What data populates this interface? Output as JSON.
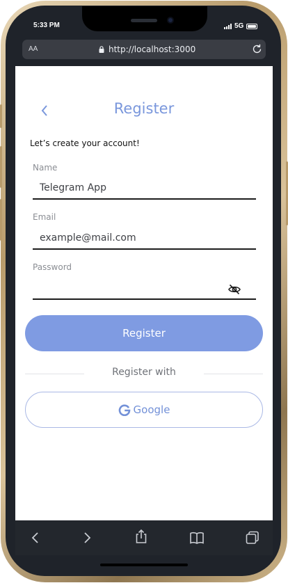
{
  "status_bar": {
    "time": "5:33 PM",
    "network": "5G"
  },
  "browser": {
    "text_size_label": "AA",
    "url": "http://localhost:3000"
  },
  "page": {
    "title": "Register",
    "subtitle": "Let’s create your account!",
    "fields": [
      {
        "label": "Name",
        "value": "Telegram App",
        "placeholder": ""
      },
      {
        "label": "Email",
        "value": "",
        "placeholder": "example@mail.com"
      },
      {
        "label": "Password",
        "value": "",
        "placeholder": ""
      }
    ],
    "register_button": "Register",
    "divider_text": "Register with",
    "google_button": "Google"
  },
  "colors": {
    "accent": "#7f9be2",
    "title": "#7a97dc",
    "google_outline": "#a9b8e5"
  },
  "icons": [
    "back-icon",
    "lock-icon",
    "reload-icon",
    "eye-off-icon",
    "google-icon",
    "browser-back-icon",
    "browser-forward-icon",
    "share-icon",
    "bookmarks-icon",
    "tabs-icon"
  ]
}
